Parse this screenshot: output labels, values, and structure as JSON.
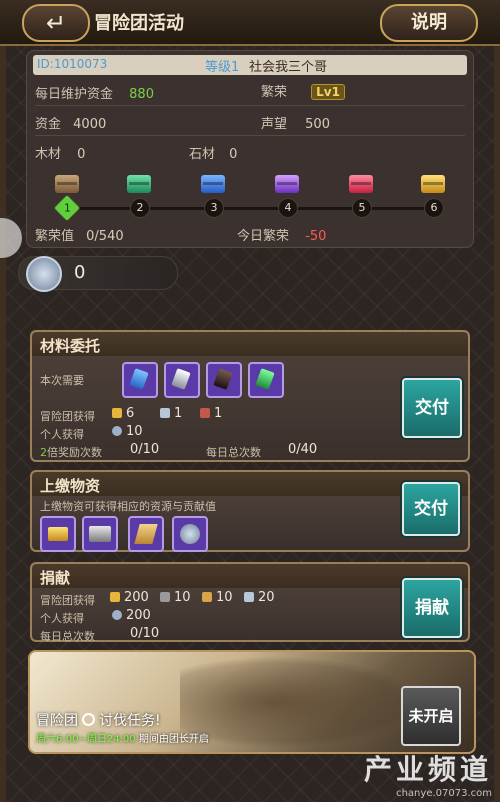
{
  "header": {
    "back_icon": "return-arrow-icon",
    "title": "冒险团活动",
    "help_label": "说明"
  },
  "info": {
    "id": "ID:1010073",
    "level": "等级1",
    "guild_name": "社会我三个哥",
    "upkeep_label": "每日维护资金",
    "upkeep_value": "880",
    "prosperity_label": "繁荣",
    "prosperity_level": "Lv1",
    "funds_label": "资金",
    "funds_value": "4000",
    "fame_label": "声望",
    "fame_value": "500",
    "wood_label": "木材",
    "wood_value": "0",
    "stone_label": "石材",
    "stone_value": "0",
    "milestones": [
      "1",
      "2",
      "3",
      "4",
      "5",
      "6"
    ],
    "prosperity_value_label": "繁荣值",
    "prosperity_value": "0/540",
    "today_label": "今日繁荣",
    "today_value": "-50"
  },
  "score": {
    "value": "0"
  },
  "materials": {
    "title": "材料委托",
    "need_label": "本次需要",
    "guild_gain_label": "冒险团获得",
    "guild_gain": [
      "6",
      "1",
      "1"
    ],
    "personal_label": "个人获得",
    "personal_value": "10",
    "bonus_label_green": "2",
    "bonus_label_rest": "倍奖励次数",
    "bonus_value": "0/10",
    "daily_label": "每日总次数",
    "daily_value": "0/40",
    "submit_label": "交付"
  },
  "tribute": {
    "title": "上缴物资",
    "desc": "上缴物资可获得相应的资源与贡献值",
    "submit_label": "交付"
  },
  "donation": {
    "title": "捐献",
    "guild_gain_label": "冒险团获得",
    "guild_gain": [
      "200",
      "10",
      "10",
      "20"
    ],
    "personal_label": "个人获得",
    "personal_value": "200",
    "daily_label": "每日总次数",
    "daily_value": "0/10",
    "donate_label": "捐献"
  },
  "event": {
    "title_left": "冒险团",
    "title_right": "讨伐任务!",
    "time_green": "周六6:00~周日24:00",
    "time_rest": "期间由团长开启",
    "closed_label": "未开启"
  },
  "watermark": {
    "main": "产业频道",
    "sub": "chanye.07073.com"
  },
  "colors": {
    "accent_teal": "#2ca5a0",
    "positive_green": "#7ccf4a",
    "negative_red": "#ff5a4a"
  }
}
